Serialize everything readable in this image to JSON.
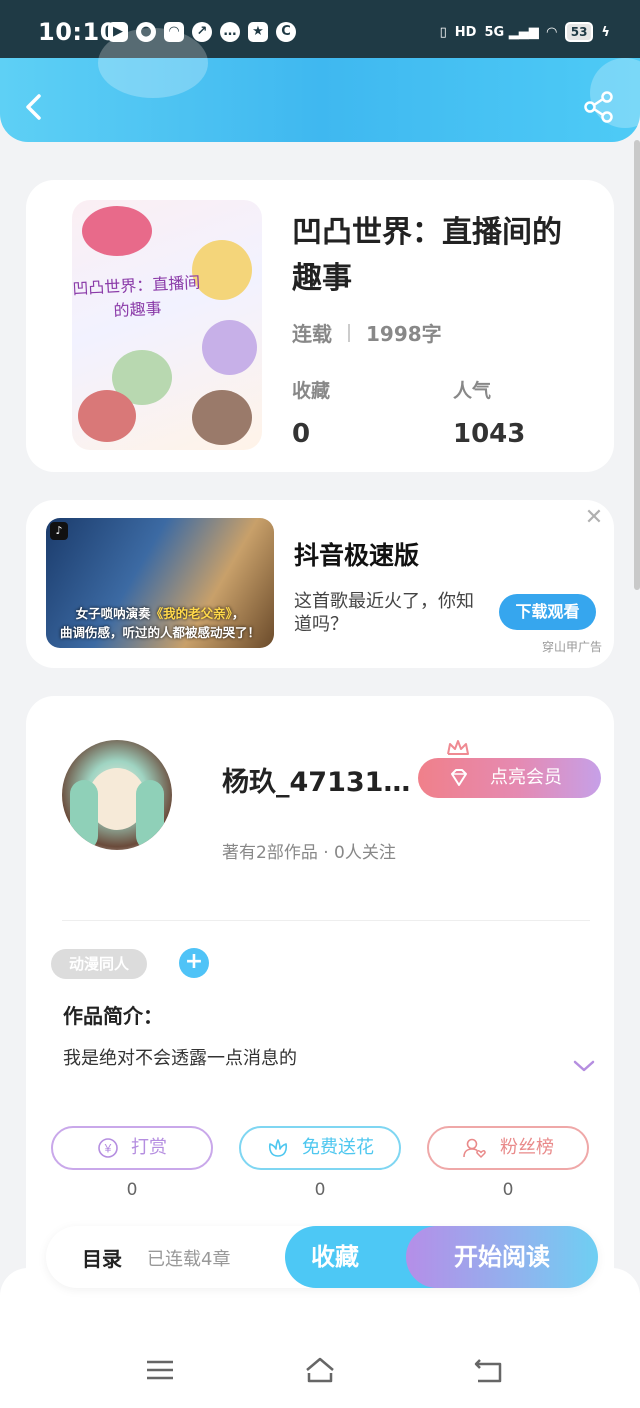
{
  "status_bar": {
    "time": "10:10",
    "network": "5G",
    "hd": "HD",
    "battery": "53"
  },
  "book": {
    "title": "凹凸世界：直播间的趣事",
    "status": "连载",
    "word_count": "1998字",
    "cover_text": "凹凸世界：直播间的趣事",
    "favorites_label": "收藏",
    "favorites_value": "0",
    "popularity_label": "人气",
    "popularity_value": "1043"
  },
  "ad": {
    "app_name": "抖音极速版",
    "description": "这首歌最近火了，你知道吗？",
    "button_label": "下载观看",
    "source": "穿山甲广告",
    "image_caption_1a": "女子唢呐演奏",
    "image_caption_1b": "《我的老父亲》",
    "image_caption_1c": "，",
    "image_caption_2": "曲调伤感，听过的人都被感动哭了！"
  },
  "author": {
    "name": "杨玖_47131…",
    "vip_label": "点亮会员",
    "stats": "著有2部作品 · 0人关注",
    "tag": "动漫同人",
    "intro_title": "作品简介：",
    "intro_text": "我是绝对不会透露一点消息的"
  },
  "actions": [
    {
      "label": "打赏",
      "count": "0",
      "color": "#b58ee0"
    },
    {
      "label": "免费送花",
      "count": "0",
      "color": "#4ec7ef"
    },
    {
      "label": "粉丝榜",
      "count": "0",
      "color": "#e98a8a"
    }
  ],
  "bottom_bar": {
    "toc_label": "目录",
    "chapters_label": "已连载4章",
    "favorite_label": "收藏",
    "read_label": "开始阅读"
  },
  "colors": {
    "header": "#3fb8f0",
    "accent_blue": "#4dc8f5",
    "vip_pink": "#f0808a",
    "read_purple": "#b58ee8"
  }
}
